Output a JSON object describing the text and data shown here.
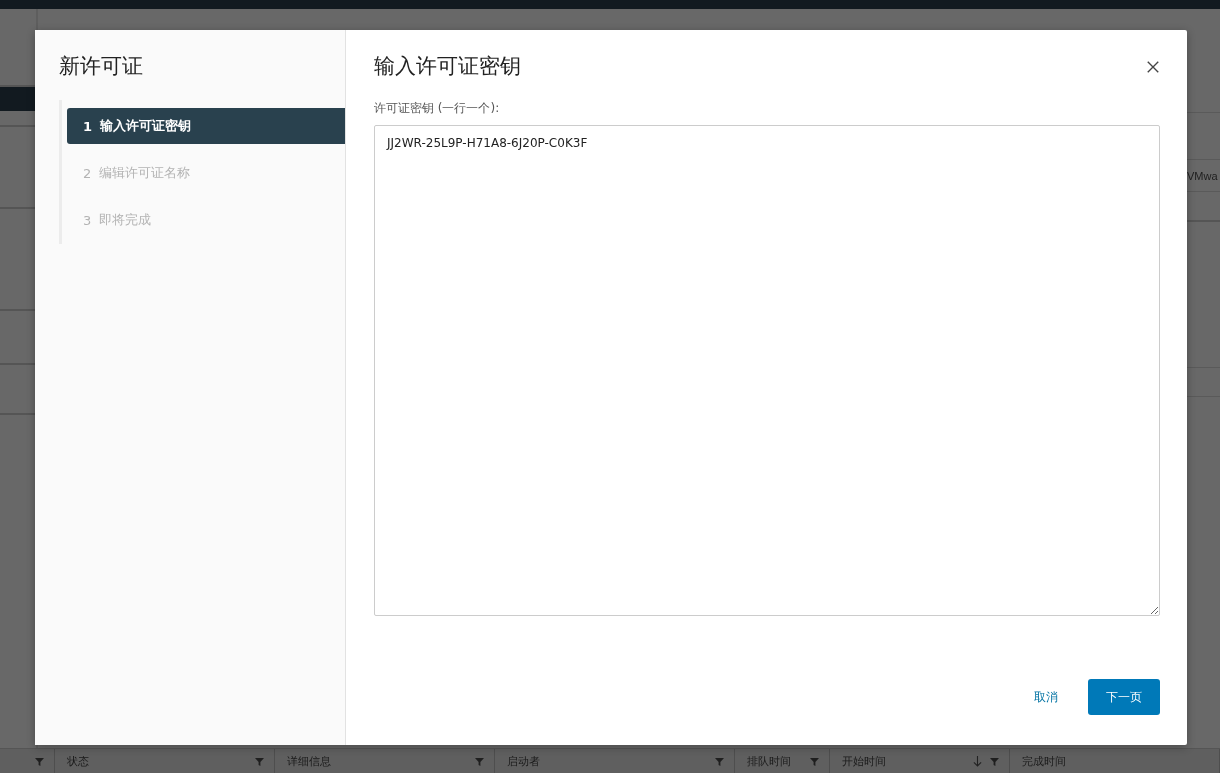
{
  "background": {
    "side_text": "VMwa",
    "table_columns": [
      {
        "sorted_descending": false
      },
      {
        "label": "状态",
        "sorted_descending": false
      },
      {
        "label": "详细信息",
        "sorted_descending": false
      },
      {
        "label": "启动者",
        "sorted_descending": false
      },
      {
        "label": "排队时间",
        "sorted_descending": false
      },
      {
        "label": "开始时间",
        "sorted_descending": true
      },
      {
        "label": "完成时间",
        "sorted_descending": false
      }
    ]
  },
  "dialog": {
    "title": "新许可证",
    "steps": [
      {
        "number": "1",
        "label": "输入许可证密钥",
        "selected": true
      },
      {
        "number": "2",
        "label": "编辑许可证名称",
        "selected": false
      },
      {
        "number": "3",
        "label": "即将完成",
        "selected": false
      }
    ],
    "heading": "输入许可证密钥",
    "field_label": "许可证密钥 (一行一个):",
    "field_value": "JJ2WR-25L9P-H71A8-6J20P-C0K3F",
    "buttons": [
      {
        "kind": "link",
        "label": "取消"
      },
      {
        "kind": "primary",
        "label": "下一页"
      }
    ]
  }
}
